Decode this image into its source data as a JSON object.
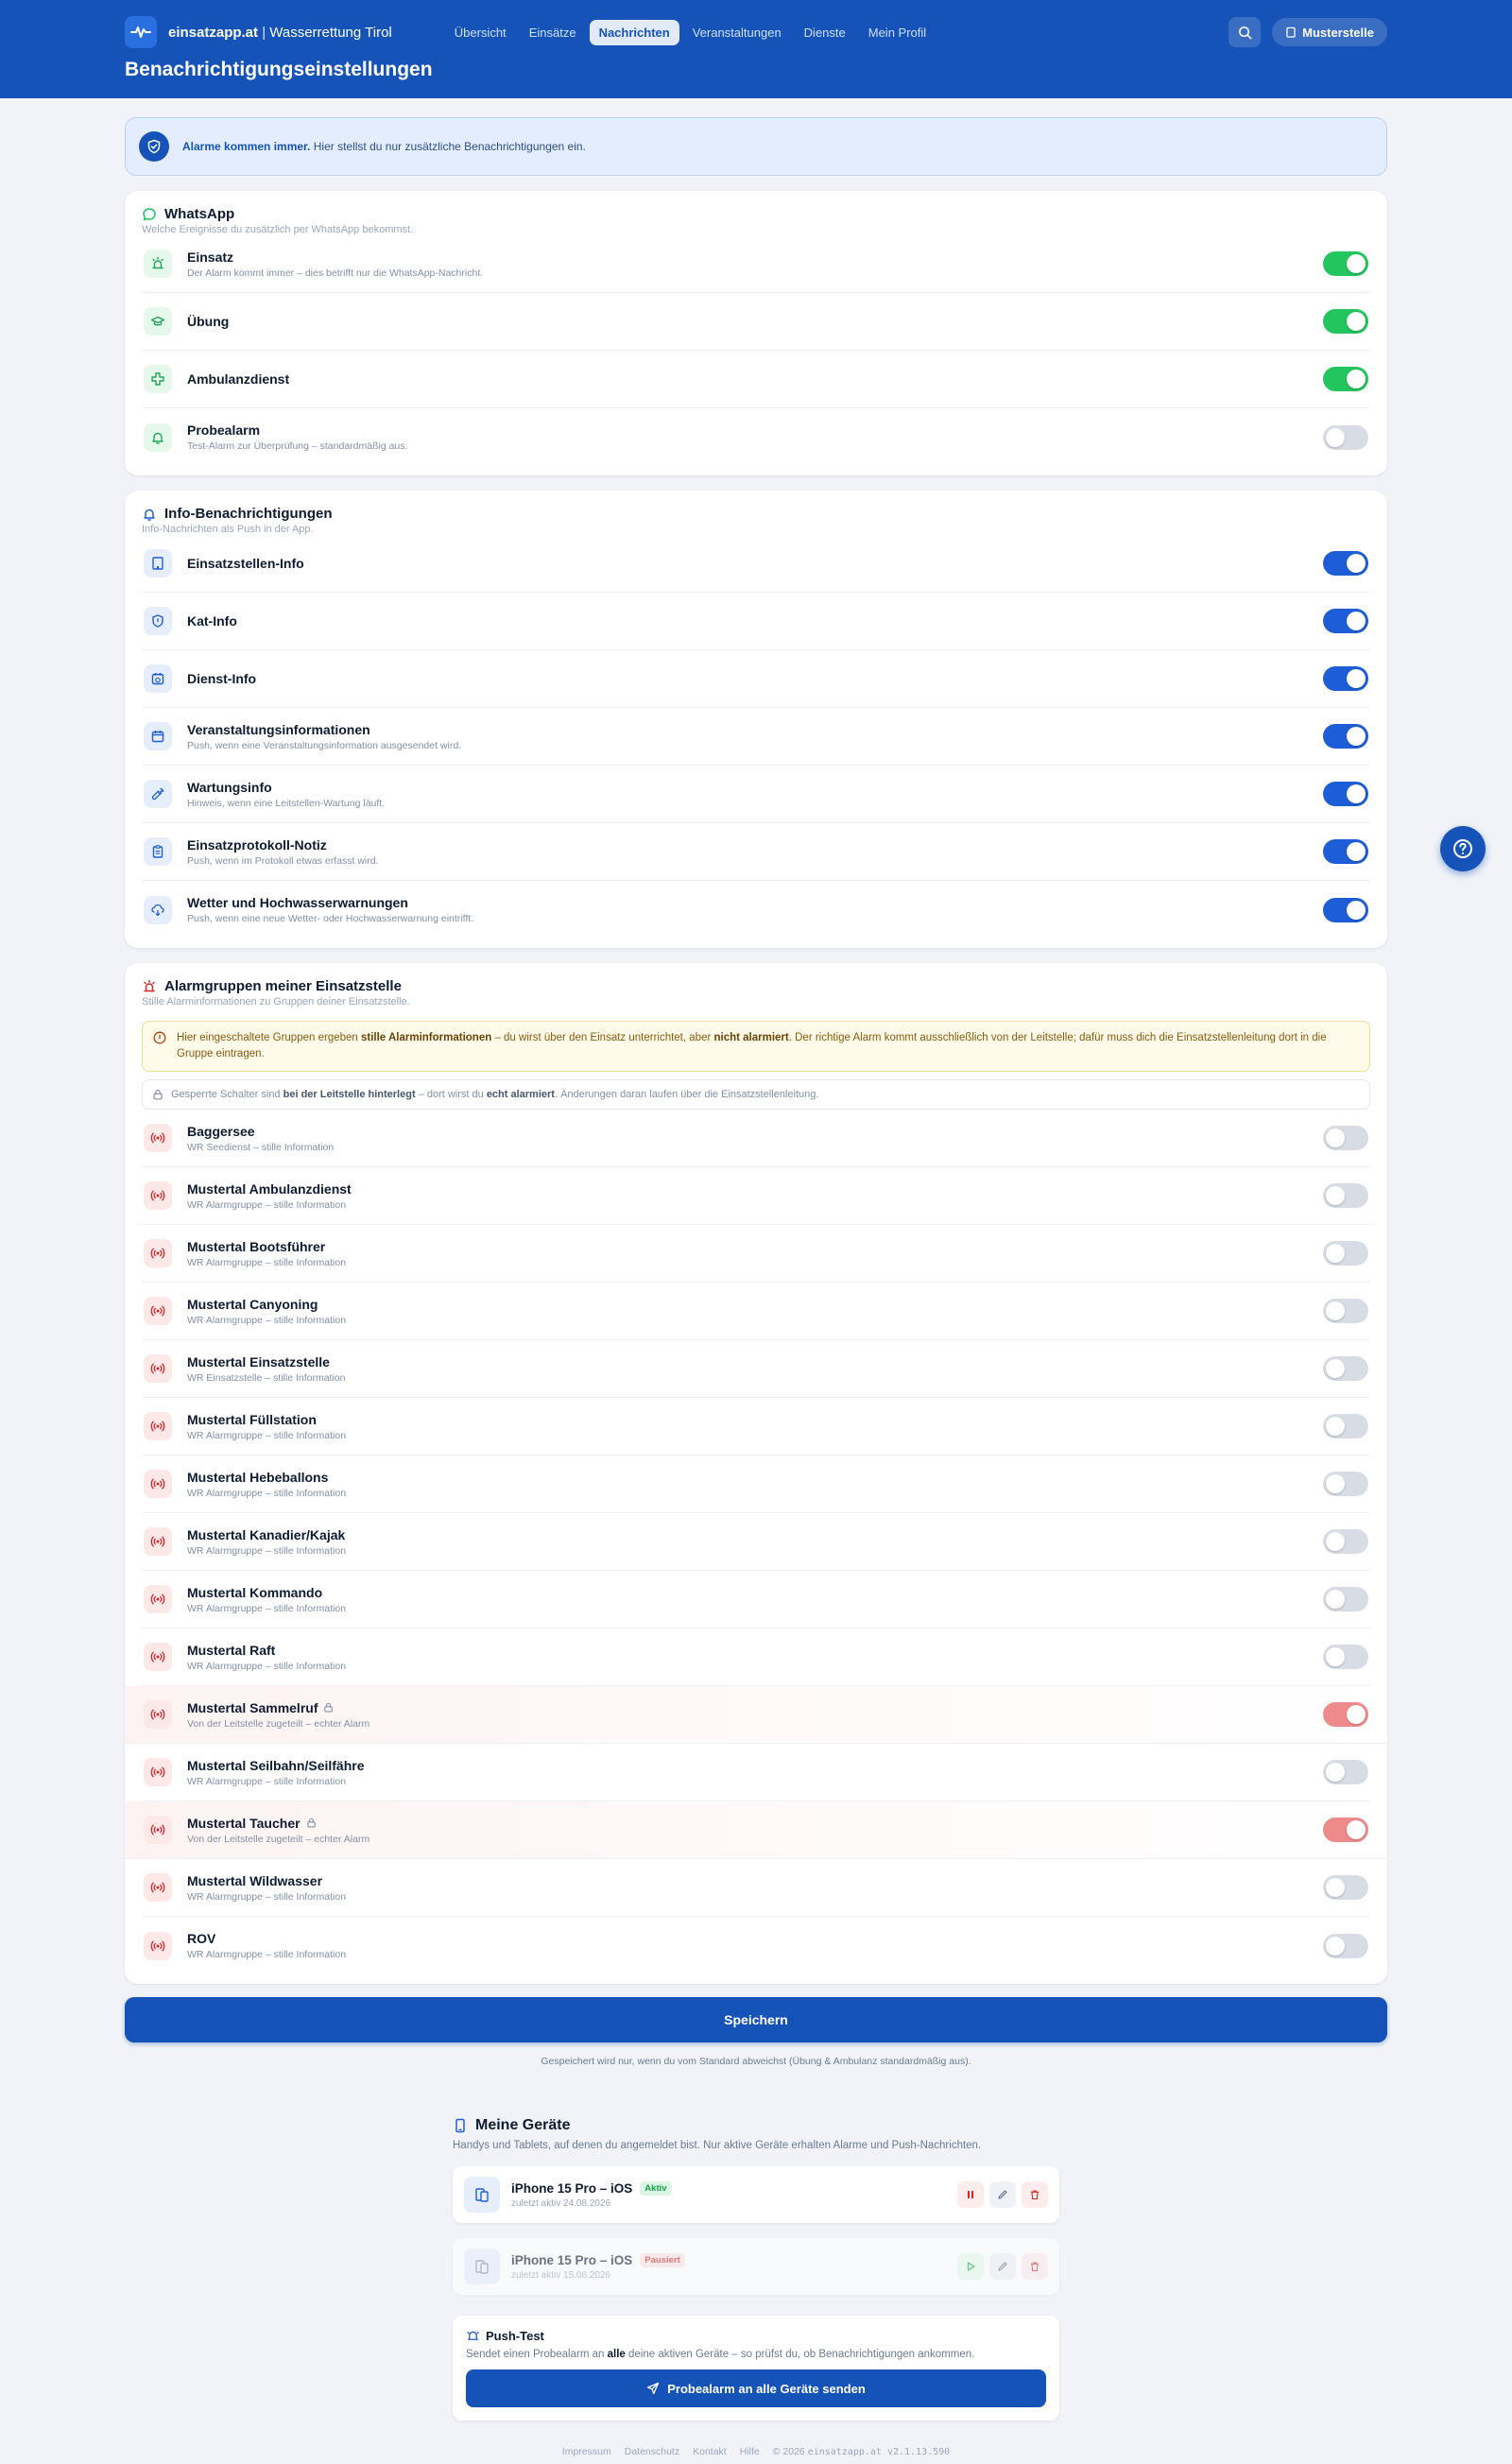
{
  "header": {
    "brand_name": "einsatzapp.at",
    "brand_sep": " | ",
    "brand_org": "Wasserrettung Tirol",
    "nav": [
      {
        "label": "Übersicht"
      },
      {
        "label": "Einsätze"
      },
      {
        "label": "Nachrichten",
        "active": true
      },
      {
        "label": "Veranstaltungen"
      },
      {
        "label": "Dienste"
      },
      {
        "label": "Mein Profil"
      }
    ],
    "station_label": "Musterstelle",
    "page_title": "Benachrichtigungseinstellungen"
  },
  "banner": {
    "bold": "Alarme kommen immer.",
    "text": " Hier stellst du nur zusätzliche Benachrichtigungen ein."
  },
  "whatsapp": {
    "title": "WhatsApp",
    "subtitle": "Welche Ereignisse du zusätzlich per WhatsApp bekommst.",
    "items": [
      {
        "label": "Einsatz",
        "sub": "Der Alarm kommt immer – dies betrifft nur die WhatsApp-Nachricht.",
        "on": true,
        "icon": "siren-icon"
      },
      {
        "label": "Übung",
        "sub": "",
        "on": true,
        "icon": "graduation-cap-icon"
      },
      {
        "label": "Ambulanzdienst",
        "sub": "",
        "on": true,
        "icon": "medical-cross-icon"
      },
      {
        "label": "Probealarm",
        "sub": "Test-Alarm zur Überprüfung – standardmäßig aus.",
        "on": false,
        "icon": "alarm-bell-icon"
      }
    ]
  },
  "info": {
    "title": "Info-Benachrichtigungen",
    "subtitle": "Info-Nachrichten als Push in der App.",
    "items": [
      {
        "label": "Einsatzstellen-Info",
        "sub": "",
        "on": true,
        "icon": "building-icon"
      },
      {
        "label": "Kat-Info",
        "sub": "",
        "on": true,
        "icon": "shield-icon"
      },
      {
        "label": "Dienst-Info",
        "sub": "",
        "on": true,
        "icon": "calendar-clock-icon"
      },
      {
        "label": "Veranstaltungsinformationen",
        "sub": "Push, wenn eine Veranstaltungsinformation ausgesendet wird.",
        "on": true,
        "icon": "calendar-icon"
      },
      {
        "label": "Wartungsinfo",
        "sub": "Hinweis, wenn eine Leitstellen-Wartung läuft.",
        "on": true,
        "icon": "wrench-icon"
      },
      {
        "label": "Einsatzprotokoll-Notiz",
        "sub": "Push, wenn im Protokoll etwas erfasst wird.",
        "on": true,
        "icon": "clipboard-icon"
      },
      {
        "label": "Wetter und Hochwasserwarnungen",
        "sub": "Push, wenn eine neue Wetter- oder Hochwasserwarnung eintrifft.",
        "on": true,
        "icon": "cloud-rain-icon"
      }
    ]
  },
  "groups": {
    "title": "Alarmgruppen meiner Einsatzstelle",
    "subtitle": "Stille Alarminformationen zu Gruppen deiner Einsatzstelle.",
    "warning": {
      "t1": "Hier eingeschaltete Gruppen ergeben ",
      "b1": "stille Alarminformationen",
      "t2": " – du wirst über den Einsatz unterrichtet, aber ",
      "b2": "nicht alarmiert",
      "t3": ". Der richtige Alarm kommt ausschließlich von der Leitstelle; dafür muss dich die Einsatzstellenleitung dort in die Gruppe eintragen."
    },
    "note": {
      "t1": "Gesperrte Schalter sind ",
      "b1": "bei der Leitstelle hinterlegt",
      "t2": " – dort wirst du ",
      "b2": "echt alarmiert",
      "t3": ". Änderungen daran laufen über die Einsatzstellenleitung."
    },
    "items": [
      {
        "label": "Baggersee",
        "sub": "WR Seedienst – stille Information",
        "on": false,
        "locked": false
      },
      {
        "label": "Mustertal Ambulanzdienst",
        "sub": "WR Alarmgruppe – stille Information",
        "on": false,
        "locked": false
      },
      {
        "label": "Mustertal Bootsführer",
        "sub": "WR Alarmgruppe – stille Information",
        "on": false,
        "locked": false
      },
      {
        "label": "Mustertal Canyoning",
        "sub": "WR Alarmgruppe – stille Information",
        "on": false,
        "locked": false
      },
      {
        "label": "Mustertal Einsatzstelle",
        "sub": "WR Einsatzstelle – stille Information",
        "on": false,
        "locked": false
      },
      {
        "label": "Mustertal Füllstation",
        "sub": "WR Alarmgruppe – stille Information",
        "on": false,
        "locked": false
      },
      {
        "label": "Mustertal Hebeballons",
        "sub": "WR Alarmgruppe – stille Information",
        "on": false,
        "locked": false
      },
      {
        "label": "Mustertal Kanadier/Kajak",
        "sub": "WR Alarmgruppe – stille Information",
        "on": false,
        "locked": false
      },
      {
        "label": "Mustertal Kommando",
        "sub": "WR Alarmgruppe – stille Information",
        "on": false,
        "locked": false
      },
      {
        "label": "Mustertal Raft",
        "sub": "WR Alarmgruppe – stille Information",
        "on": false,
        "locked": false
      },
      {
        "label": "Mustertal Sammelruf",
        "sub": "Von der Leitstelle zugeteilt – echter Alarm",
        "on": true,
        "locked": true
      },
      {
        "label": "Mustertal Seilbahn/Seilfähre",
        "sub": "WR Alarmgruppe – stille Information",
        "on": false,
        "locked": false
      },
      {
        "label": "Mustertal Taucher",
        "sub": "Von der Leitstelle zugeteilt – echter Alarm",
        "on": true,
        "locked": true
      },
      {
        "label": "Mustertal Wildwasser",
        "sub": "WR Alarmgruppe – stille Information",
        "on": false,
        "locked": false
      },
      {
        "label": "ROV",
        "sub": "WR Alarmgruppe – stille Information",
        "on": false,
        "locked": false
      }
    ]
  },
  "save": {
    "label": "Speichern",
    "note": "Gespeichert wird nur, wenn du vom Standard abweichst (Übung & Ambulanz standardmäßig aus)."
  },
  "devices": {
    "title": "Meine Geräte",
    "subtitle": "Handys und Tablets, auf denen du angemeldet bist. Nur aktive Geräte erhalten Alarme und Push-Nachrichten.",
    "items": [
      {
        "name": "iPhone 15 Pro – iOS",
        "badge": "Aktiv",
        "status": "active",
        "seen": "zuletzt aktiv 24.08.2026"
      },
      {
        "name": "iPhone 15 Pro – iOS",
        "badge": "Pausiert",
        "status": "paused",
        "seen": "zuletzt aktiv 15.08.2026"
      }
    ],
    "push": {
      "title": "Push-Test",
      "t1": "Sendet einen Probealarm an ",
      "b1": "alle",
      "t2": " deine aktiven Geräte – so prüfst du, ob Benachrichtigungen ankommen.",
      "button": "Probealarm an alle Geräte senden"
    }
  },
  "footer": {
    "links": [
      "Impressum",
      "Datenschutz",
      "Kontakt",
      "Hilfe"
    ],
    "copyright": "© 2026",
    "version": "einsatzapp.at v2.1.13.590"
  },
  "colors": {
    "primary": "#1553b8",
    "toggle_green": "#22c55e",
    "toggle_blue": "#1d5ed8",
    "toggle_red_locked": "#ef8a8a",
    "toggle_off": "#d8dce4"
  }
}
